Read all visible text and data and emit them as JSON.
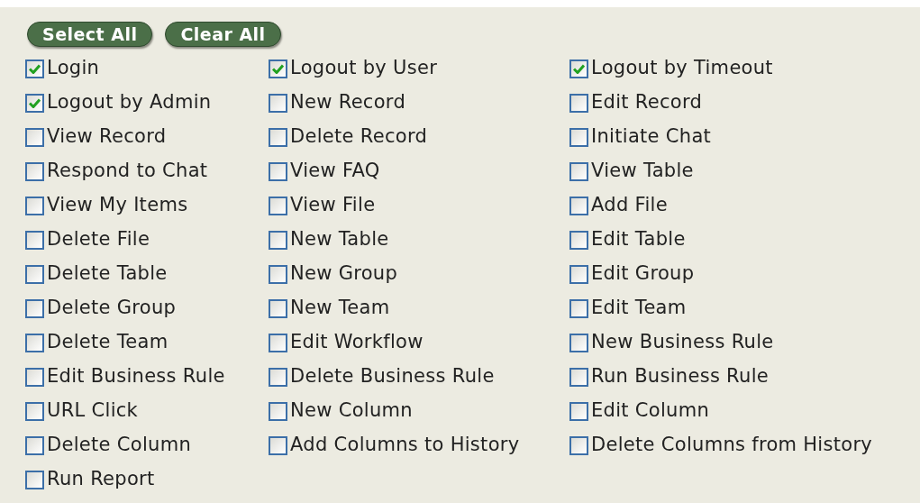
{
  "buttons": [
    "Select All",
    "Clear All"
  ],
  "options": [
    {
      "label": "Login",
      "checked": true
    },
    {
      "label": "Logout by User",
      "checked": true
    },
    {
      "label": "Logout by Timeout",
      "checked": true
    },
    {
      "label": "Logout by Admin",
      "checked": true
    },
    {
      "label": "New Record",
      "checked": false
    },
    {
      "label": "Edit Record",
      "checked": false
    },
    {
      "label": "View Record",
      "checked": false
    },
    {
      "label": "Delete Record",
      "checked": false
    },
    {
      "label": "Initiate Chat",
      "checked": false
    },
    {
      "label": "Respond to Chat",
      "checked": false
    },
    {
      "label": "View FAQ",
      "checked": false
    },
    {
      "label": "View Table",
      "checked": false
    },
    {
      "label": "View My Items",
      "checked": false
    },
    {
      "label": "View File",
      "checked": false
    },
    {
      "label": "Add File",
      "checked": false
    },
    {
      "label": "Delete File",
      "checked": false
    },
    {
      "label": "New Table",
      "checked": false
    },
    {
      "label": "Edit Table",
      "checked": false
    },
    {
      "label": "Delete Table",
      "checked": false
    },
    {
      "label": "New Group",
      "checked": false
    },
    {
      "label": "Edit Group",
      "checked": false
    },
    {
      "label": "Delete Group",
      "checked": false
    },
    {
      "label": "New Team",
      "checked": false
    },
    {
      "label": "Edit Team",
      "checked": false
    },
    {
      "label": "Delete Team",
      "checked": false
    },
    {
      "label": "Edit Workflow",
      "checked": false
    },
    {
      "label": "New Business Rule",
      "checked": false
    },
    {
      "label": "Edit Business Rule",
      "checked": false
    },
    {
      "label": "Delete Business Rule",
      "checked": false
    },
    {
      "label": "Run Business Rule",
      "checked": false
    },
    {
      "label": "URL Click",
      "checked": false
    },
    {
      "label": "New Column",
      "checked": false
    },
    {
      "label": "Edit Column",
      "checked": false
    },
    {
      "label": "Delete Column",
      "checked": false
    },
    {
      "label": "Add Columns to History",
      "checked": false
    },
    {
      "label": "Delete Columns from History",
      "checked": false
    },
    {
      "label": "Run Report",
      "checked": false
    }
  ]
}
